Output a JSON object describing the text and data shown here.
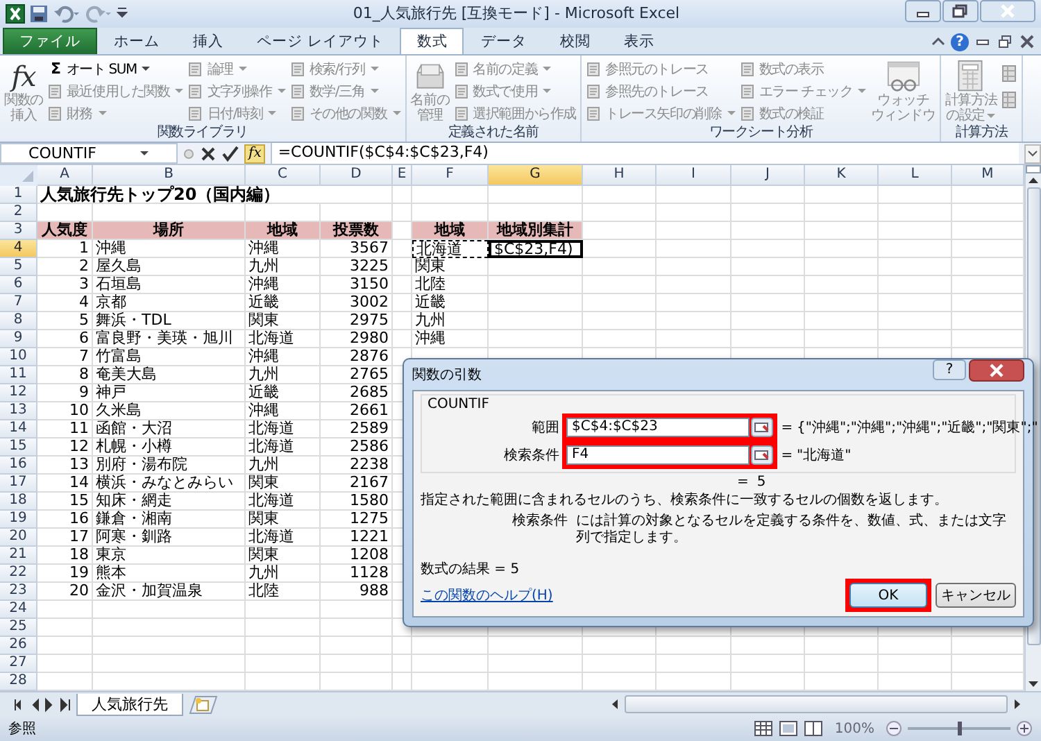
{
  "window": {
    "title": "01_人気旅行先 [互換モード] - Microsoft Excel"
  },
  "ribbon_tabs": [
    {
      "label": "ファイル",
      "kind": "file",
      "selected": false
    },
    {
      "label": "ホーム",
      "kind": "tab",
      "selected": false
    },
    {
      "label": "挿入",
      "kind": "tab",
      "selected": false
    },
    {
      "label": "ページ レイアウト",
      "kind": "tab",
      "selected": false
    },
    {
      "label": "数式",
      "kind": "tab",
      "selected": true
    },
    {
      "label": "データ",
      "kind": "tab",
      "selected": false
    },
    {
      "label": "校閲",
      "kind": "tab",
      "selected": false
    },
    {
      "label": "表示",
      "kind": "tab",
      "selected": false
    }
  ],
  "ribbon_help": "?",
  "ribbon_groups": [
    {
      "label": "関数ライブラリ",
      "columns": [
        [
          {
            "kind": "function",
            "symbol": "fx",
            "lines": [
              "関数の",
              "挿入"
            ],
            "disabled": true
          }
        ],
        [
          {
            "kind": "small",
            "symbol": "Σ",
            "label": "オート SUM",
            "dropdown": true,
            "disabled": false
          },
          {
            "kind": "small",
            "label": "最近使用した関数",
            "dropdown": true,
            "disabled": true
          },
          {
            "kind": "small",
            "label": "財務",
            "dropdown": true,
            "disabled": true
          }
        ],
        [
          {
            "kind": "small",
            "label": "論理",
            "dropdown": true,
            "disabled": true
          },
          {
            "kind": "small",
            "label": "文字列操作",
            "dropdown": true,
            "disabled": true
          },
          {
            "kind": "small",
            "label": "日付/時刻",
            "dropdown": true,
            "disabled": true
          }
        ],
        [
          {
            "kind": "small",
            "label": "検索/行列",
            "dropdown": true,
            "disabled": true
          },
          {
            "kind": "small",
            "label": "数学/三角",
            "dropdown": true,
            "disabled": true
          },
          {
            "kind": "small",
            "label": "その他の関数",
            "dropdown": true,
            "disabled": true
          }
        ]
      ]
    },
    {
      "label": "定義された名前",
      "columns": [
        [
          {
            "kind": "names",
            "lines": [
              "名前の",
              "管理"
            ],
            "disabled": true
          }
        ],
        [
          {
            "kind": "small",
            "label": "名前の定義",
            "dropdown": true,
            "disabled": true
          },
          {
            "kind": "small",
            "label": "数式で使用",
            "dropdown": true,
            "disabled": true
          },
          {
            "kind": "small",
            "label": "選択範囲から作成",
            "dropdown": false,
            "disabled": true
          }
        ]
      ]
    },
    {
      "label": "ワークシート分析",
      "columns": [
        [
          {
            "kind": "small",
            "label": "参照元のトレース",
            "dropdown": false,
            "disabled": true
          },
          {
            "kind": "small",
            "label": "参照先のトレース",
            "dropdown": false,
            "disabled": true
          },
          {
            "kind": "small",
            "label": "トレース矢印の削除",
            "dropdown": true,
            "disabled": true
          }
        ],
        [
          {
            "kind": "small",
            "label": "数式の表示",
            "dropdown": false,
            "disabled": true
          },
          {
            "kind": "small",
            "label": "エラー チェック",
            "dropdown": true,
            "disabled": true
          },
          {
            "kind": "small",
            "label": "数式の検証",
            "dropdown": false,
            "disabled": true
          }
        ],
        [
          {
            "kind": "watch",
            "lines": [
              "ウォッチ",
              "ウィンドウ"
            ],
            "disabled": true
          }
        ]
      ]
    },
    {
      "label": "計算方法",
      "columns": [
        [
          {
            "kind": "calculation",
            "lines": [
              "計算方法",
              "の設定"
            ],
            "dropdown": true,
            "disabled": true
          }
        ],
        [
          {
            "kind": "icon",
            "disabled": true
          },
          {
            "kind": "icon",
            "disabled": true
          }
        ]
      ]
    }
  ],
  "formula_bar": {
    "name_box": "COUNTIF",
    "function_symbol": "fx",
    "formula": "=COUNTIF($C$4:$C$23,F4)"
  },
  "sheet": {
    "columns": [
      {
        "label": "A",
        "selected": false
      },
      {
        "label": "B",
        "selected": false
      },
      {
        "label": "C",
        "selected": false
      },
      {
        "label": "D",
        "selected": false
      },
      {
        "label": "E",
        "selected": false
      },
      {
        "label": "F",
        "selected": false
      },
      {
        "label": "G",
        "selected": true
      },
      {
        "label": "H",
        "selected": false
      },
      {
        "label": "I",
        "selected": false
      },
      {
        "label": "J",
        "selected": false
      },
      {
        "label": "K",
        "selected": false
      },
      {
        "label": "L",
        "selected": false
      },
      {
        "label": "M",
        "selected": false
      }
    ],
    "rows": [
      {
        "number": "1",
        "kind": "title",
        "selected": false,
        "cells": {
          "A": {
            "text": "人気旅行先トップ20（国内編）"
          }
        }
      },
      {
        "number": "2",
        "kind": "data",
        "selected": false
      },
      {
        "number": "3",
        "kind": "header",
        "selected": false,
        "cells": {
          "A": {
            "text": "人気度"
          },
          "B": {
            "text": "場所"
          },
          "C": {
            "text": "地域"
          },
          "D": {
            "text": "投票数"
          },
          "F": {
            "text": "地域"
          },
          "G": {
            "text": "地域別集計"
          }
        }
      },
      {
        "number": "4",
        "kind": "data",
        "selected": true,
        "cells": {
          "A": {
            "text": "1",
            "kind": "number"
          },
          "B": {
            "text": "沖縄"
          },
          "C": {
            "text": "沖縄"
          },
          "D": {
            "text": "3567",
            "kind": "number"
          },
          "F": {
            "text": "北海道",
            "referenced": true
          },
          "G": {
            "text": "$C$23,F4)",
            "active": true
          }
        }
      },
      {
        "number": "5",
        "kind": "data",
        "selected": false,
        "cells": {
          "A": {
            "text": "2",
            "kind": "number"
          },
          "B": {
            "text": "屋久島"
          },
          "C": {
            "text": "九州"
          },
          "D": {
            "text": "3225",
            "kind": "number"
          },
          "F": {
            "text": "関東"
          }
        }
      },
      {
        "number": "6",
        "kind": "data",
        "selected": false,
        "cells": {
          "A": {
            "text": "3",
            "kind": "number"
          },
          "B": {
            "text": "石垣島"
          },
          "C": {
            "text": "沖縄"
          },
          "D": {
            "text": "3150",
            "kind": "number"
          },
          "F": {
            "text": "北陸"
          }
        }
      },
      {
        "number": "7",
        "kind": "data",
        "selected": false,
        "cells": {
          "A": {
            "text": "4",
            "kind": "number"
          },
          "B": {
            "text": "京都"
          },
          "C": {
            "text": "近畿"
          },
          "D": {
            "text": "3002",
            "kind": "number"
          },
          "F": {
            "text": "近畿"
          }
        }
      },
      {
        "number": "8",
        "kind": "data",
        "selected": false,
        "cells": {
          "A": {
            "text": "5",
            "kind": "number"
          },
          "B": {
            "text": "舞浜・TDL"
          },
          "C": {
            "text": "関東"
          },
          "D": {
            "text": "2975",
            "kind": "number"
          },
          "F": {
            "text": "九州"
          }
        }
      },
      {
        "number": "9",
        "kind": "data",
        "selected": false,
        "cells": {
          "A": {
            "text": "6",
            "kind": "number"
          },
          "B": {
            "text": "富良野・美瑛・旭川"
          },
          "C": {
            "text": "北海道"
          },
          "D": {
            "text": "2980",
            "kind": "number"
          },
          "F": {
            "text": "沖縄"
          }
        }
      },
      {
        "number": "10",
        "kind": "data",
        "selected": false,
        "cells": {
          "A": {
            "text": "7",
            "kind": "number"
          },
          "B": {
            "text": "竹富島"
          },
          "C": {
            "text": "沖縄"
          },
          "D": {
            "text": "2876",
            "kind": "number"
          }
        }
      },
      {
        "number": "11",
        "kind": "data",
        "selected": false,
        "cells": {
          "A": {
            "text": "8",
            "kind": "number"
          },
          "B": {
            "text": "奄美大島"
          },
          "C": {
            "text": "九州"
          },
          "D": {
            "text": "2765",
            "kind": "number"
          }
        }
      },
      {
        "number": "12",
        "kind": "data",
        "selected": false,
        "cells": {
          "A": {
            "text": "9",
            "kind": "number"
          },
          "B": {
            "text": "神戸"
          },
          "C": {
            "text": "近畿"
          },
          "D": {
            "text": "2685",
            "kind": "number"
          }
        }
      },
      {
        "number": "13",
        "kind": "data",
        "selected": false,
        "cells": {
          "A": {
            "text": "10",
            "kind": "number"
          },
          "B": {
            "text": "久米島"
          },
          "C": {
            "text": "沖縄"
          },
          "D": {
            "text": "2661",
            "kind": "number"
          }
        }
      },
      {
        "number": "14",
        "kind": "data",
        "selected": false,
        "cells": {
          "A": {
            "text": "11",
            "kind": "number"
          },
          "B": {
            "text": "函館・大沼"
          },
          "C": {
            "text": "北海道"
          },
          "D": {
            "text": "2589",
            "kind": "number"
          }
        }
      },
      {
        "number": "15",
        "kind": "data",
        "selected": false,
        "cells": {
          "A": {
            "text": "12",
            "kind": "number"
          },
          "B": {
            "text": "札幌・小樽"
          },
          "C": {
            "text": "北海道"
          },
          "D": {
            "text": "2586",
            "kind": "number"
          }
        }
      },
      {
        "number": "16",
        "kind": "data",
        "selected": false,
        "cells": {
          "A": {
            "text": "13",
            "kind": "number"
          },
          "B": {
            "text": "別府・湯布院"
          },
          "C": {
            "text": "九州"
          },
          "D": {
            "text": "2238",
            "kind": "number"
          }
        }
      },
      {
        "number": "17",
        "kind": "data",
        "selected": false,
        "cells": {
          "A": {
            "text": "14",
            "kind": "number"
          },
          "B": {
            "text": "横浜・みなとみらい"
          },
          "C": {
            "text": "関東"
          },
          "D": {
            "text": "2167",
            "kind": "number"
          }
        }
      },
      {
        "number": "18",
        "kind": "data",
        "selected": false,
        "cells": {
          "A": {
            "text": "15",
            "kind": "number"
          },
          "B": {
            "text": "知床・網走"
          },
          "C": {
            "text": "北海道"
          },
          "D": {
            "text": "1580",
            "kind": "number"
          }
        }
      },
      {
        "number": "19",
        "kind": "data",
        "selected": false,
        "cells": {
          "A": {
            "text": "16",
            "kind": "number"
          },
          "B": {
            "text": "鎌倉・湘南"
          },
          "C": {
            "text": "関東"
          },
          "D": {
            "text": "1275",
            "kind": "number"
          }
        }
      },
      {
        "number": "20",
        "kind": "data",
        "selected": false,
        "cells": {
          "A": {
            "text": "17",
            "kind": "number"
          },
          "B": {
            "text": "阿寒・釧路"
          },
          "C": {
            "text": "北海道"
          },
          "D": {
            "text": "1221",
            "kind": "number"
          }
        }
      },
      {
        "number": "21",
        "kind": "data",
        "selected": false,
        "cells": {
          "A": {
            "text": "18",
            "kind": "number"
          },
          "B": {
            "text": "東京"
          },
          "C": {
            "text": "関東"
          },
          "D": {
            "text": "1208",
            "kind": "number"
          }
        }
      },
      {
        "number": "22",
        "kind": "data",
        "selected": false,
        "cells": {
          "A": {
            "text": "19",
            "kind": "number"
          },
          "B": {
            "text": "熊本"
          },
          "C": {
            "text": "九州"
          },
          "D": {
            "text": "1128",
            "kind": "number"
          }
        }
      },
      {
        "number": "23",
        "kind": "data",
        "selected": false,
        "cells": {
          "A": {
            "text": "20",
            "kind": "number"
          },
          "B": {
            "text": "金沢・加賀温泉"
          },
          "C": {
            "text": "北陸"
          },
          "D": {
            "text": "988",
            "kind": "number"
          }
        }
      },
      {
        "number": "24",
        "kind": "data",
        "selected": false
      },
      {
        "number": "25",
        "kind": "data",
        "selected": false
      },
      {
        "number": "26",
        "kind": "data",
        "selected": false
      },
      {
        "number": "27",
        "kind": "data",
        "selected": false
      },
      {
        "number": "28",
        "kind": "data",
        "selected": false
      }
    ]
  },
  "sheet_tabs": [
    {
      "label": "人気旅行先",
      "selected": true
    }
  ],
  "status_bar": {
    "mode": "参照",
    "zoom": "100%",
    "zoom_slider": {
      "level": 0.5
    }
  },
  "dialog": {
    "title": "関数の引数",
    "help_button": "?",
    "function_name": "COUNTIF",
    "arguments": [
      {
        "label": "範囲",
        "value": "$C$4:$C$23",
        "highlighted": true,
        "equals": "=",
        "result": "{\"沖縄\";\"沖縄\";\"沖縄\";\"近畿\";\"関東\";\""
      },
      {
        "label": "検索条件",
        "value": "F4",
        "highlighted": true,
        "equals": "=",
        "result": "\"北海道\""
      }
    ],
    "value": {
      "equals": "=",
      "result": "5"
    },
    "description": "指定された範囲に含まれるセルのうち、検索条件に一致するセルの個数を返します。",
    "argument_help": {
      "label": "検索条件",
      "text": "には計算の対象となるセルを定義する条件を、数値、式、または文字列で指定します。"
    },
    "formula_result": "数式の結果 =  5",
    "help_link": "この関数のヘルプ(H)",
    "buttons": [
      {
        "label": "OK",
        "kind": "default",
        "highlighted": true
      },
      {
        "label": "キャンセル",
        "kind": "normal",
        "highlighted": false
      }
    ]
  }
}
